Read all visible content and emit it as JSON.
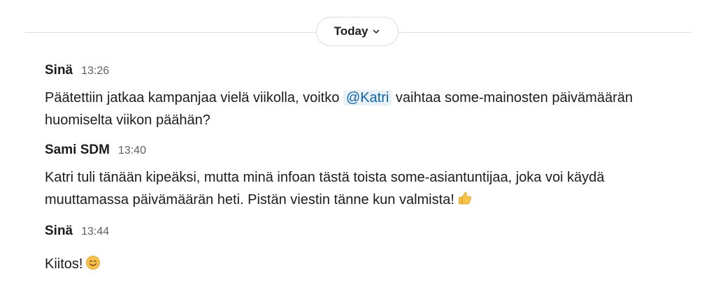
{
  "divider": {
    "label": "Today",
    "chevron_icon": "chevron-down-icon"
  },
  "messages": [
    {
      "sender": "Sinä",
      "time": "13:26",
      "text_before": "Päätettiin jatkaa kampanjaa vielä viikolla, voitko ",
      "mention": "@Katri",
      "text_after": " vaihtaa some-mainosten päivämäärän huomiselta viikon päähän?"
    },
    {
      "sender": "Sami SDM",
      "time": "13:40",
      "text": "Katri tuli tänään kipeäksi, mutta minä infoan tästä toista some-asiantuntijaa, joka voi käydä muuttamassa päivämäärän heti. Pistän viestin tänne kun valmista!",
      "emoji": "thumbs-up-icon"
    },
    {
      "sender": "Sinä",
      "time": "13:44",
      "text": "Kiitos!",
      "emoji": "smiling-face-icon"
    }
  ],
  "colors": {
    "mention_bg": "#e8f1f8",
    "mention_text": "#1264a3",
    "timestamp": "#616061",
    "divider": "#dddddd"
  }
}
